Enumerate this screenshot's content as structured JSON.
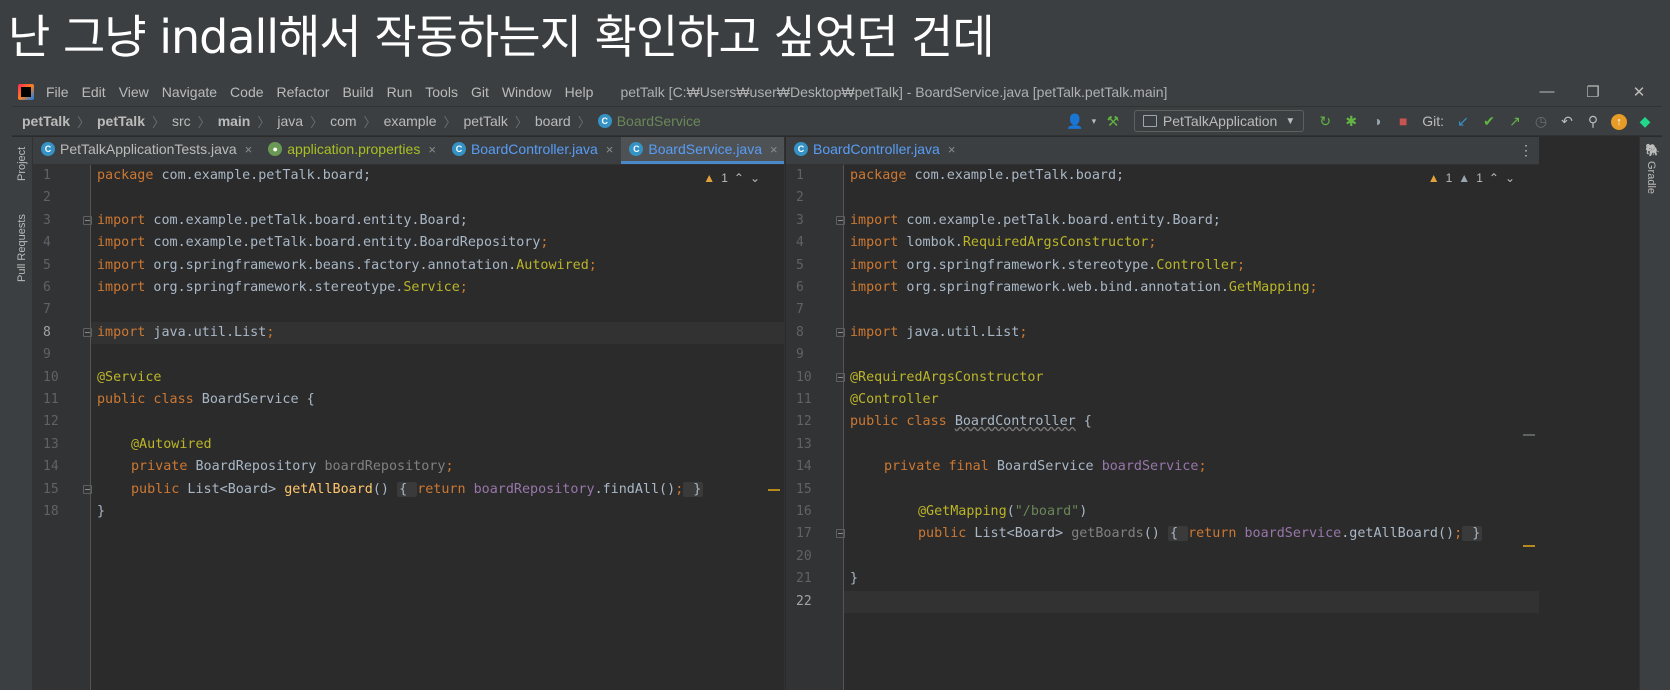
{
  "caption": "난 그냥  indall해서 작동하는지 확인하고 싶었던 건데",
  "menu": [
    "File",
    "Edit",
    "View",
    "Navigate",
    "Code",
    "Refactor",
    "Build",
    "Run",
    "Tools",
    "Git",
    "Window",
    "Help"
  ],
  "window_title": "petTalk [C:₩Users₩user₩Desktop₩petTalk] - BoardService.java [petTalk.petTalk.main]",
  "window_controls": {
    "minimize": "—",
    "restore": "❐",
    "close": "✕"
  },
  "breadcrumbs": [
    "petTalk",
    "petTalk",
    "src",
    "main",
    "java",
    "com",
    "example",
    "petTalk",
    "board",
    "BoardService"
  ],
  "run_config": "PetTalkApplication",
  "git_label": "Git:",
  "left_strip": {
    "project": "Project",
    "pull_requests": "Pull Requests"
  },
  "right_strip": {
    "gradle": "Gradle"
  },
  "left_tabs": [
    {
      "label": "PetTalkApplicationTests.java",
      "close": "×"
    },
    {
      "label": "application.properties",
      "close": "×"
    },
    {
      "label": "BoardController.java",
      "close": "×"
    },
    {
      "label": "BoardService.java",
      "close": "×"
    }
  ],
  "right_tabs": [
    {
      "label": "BoardController.java",
      "close": "×"
    }
  ],
  "left_indicator": "1",
  "right_indicator": {
    "a": "1",
    "b": "1"
  },
  "left_code": {
    "l1": {
      "n": "1",
      "kw": "package",
      "rest": " com.example.petTalk.board;"
    },
    "l2": {
      "n": "2"
    },
    "l3": {
      "n": "3",
      "kw": "import",
      "rest": " com.example.petTalk.board.entity.Board;"
    },
    "l4": {
      "n": "4",
      "kw": "import",
      "rest": " com.example.petTalk.board.entity.",
      "hl": "BoardRepository",
      "end": ";"
    },
    "l5": {
      "n": "5",
      "kw": "import",
      "rest": " org.springframework.beans.factory.annotation.",
      "hl": "Autowired",
      "end": ";"
    },
    "l6": {
      "n": "6",
      "kw": "import",
      "rest": " org.springframework.stereotype.",
      "hl": "Service",
      "end": ";"
    },
    "l7": {
      "n": "7"
    },
    "l8": {
      "n": "8",
      "kw": "import",
      "rest": " java.util.List",
      "end": ";"
    },
    "l9": {
      "n": "9"
    },
    "l10": {
      "n": "10",
      "ann": "@Service"
    },
    "l11": {
      "n": "11",
      "kw": "public class",
      "rest": " BoardService {"
    },
    "l12": {
      "n": "12"
    },
    "l13": {
      "n": "13",
      "ann": "@Autowired"
    },
    "l14": {
      "n": "14",
      "kw": "private",
      "rest": " BoardRepository ",
      "fld": "boardRepository",
      "end": ";"
    },
    "l15": {
      "n": "15",
      "kw": "public",
      "rest": " List<Board> ",
      "fn": "getAllBoard",
      "paren": "() ",
      "brace_open": "{ ",
      "kw2": "return",
      "fld": " boardRepository",
      "rest2": ".findAll()",
      "end": ";",
      "brace_close": " }"
    },
    "l18": {
      "n": "18",
      "rest": "}"
    }
  },
  "right_code": {
    "l1": {
      "n": "1",
      "kw": "package",
      "rest": " com.example.petTalk.board;"
    },
    "l2": {
      "n": "2"
    },
    "l3": {
      "n": "3",
      "kw": "import",
      "rest": " com.example.petTalk.board.entity.Board;"
    },
    "l4": {
      "n": "4",
      "kw": "import",
      "rest": " lombok.",
      "hl": "RequiredArgsConstructor",
      "end": ";"
    },
    "l5": {
      "n": "5",
      "kw": "import",
      "rest": " org.springframework.stereotype.",
      "hl": "Controller",
      "end": ";"
    },
    "l6": {
      "n": "6",
      "kw": "import",
      "rest": " org.springframework.web.bind.annotation.",
      "hl": "GetMapping",
      "end": ";"
    },
    "l7": {
      "n": "7"
    },
    "l8": {
      "n": "8",
      "kw": "import",
      "rest": " java.util.List",
      "end": ";"
    },
    "l9": {
      "n": "9"
    },
    "l10": {
      "n": "10",
      "ann": "@RequiredArgsConstructor"
    },
    "l11": {
      "n": "11",
      "ann": "@Controller"
    },
    "l12": {
      "n": "12",
      "kw": "public class",
      "rest": " ",
      "cls": "BoardController",
      "end": " {"
    },
    "l13": {
      "n": "13"
    },
    "l14": {
      "n": "14",
      "kw": "private final",
      "rest": " BoardService ",
      "fld": "boardService",
      "end": ";"
    },
    "l15": {
      "n": "15"
    },
    "l16": {
      "n": "16",
      "ann": "@GetMapping",
      "paren": "(",
      "str": "\"/board\"",
      "end": ")"
    },
    "l17": {
      "n": "17",
      "kw": "public",
      "rest": " List<Board> ",
      "dimfn": "getBoards",
      "paren": "() ",
      "brace_open": "{ ",
      "kw2": "return",
      "fld": " boardService",
      "rest2": ".getAllBoard()",
      "end": ";",
      "brace_close": " }"
    },
    "l20": {
      "n": "20"
    },
    "l21": {
      "n": "21",
      "rest": "}"
    },
    "l22": {
      "n": "22"
    }
  },
  "colors": {
    "keyword": "#cc7832",
    "annotation": "#bbb529",
    "field": "#9876aa",
    "method": "#ffc66d",
    "string": "#6a8759",
    "active_tab": "#589df6"
  }
}
